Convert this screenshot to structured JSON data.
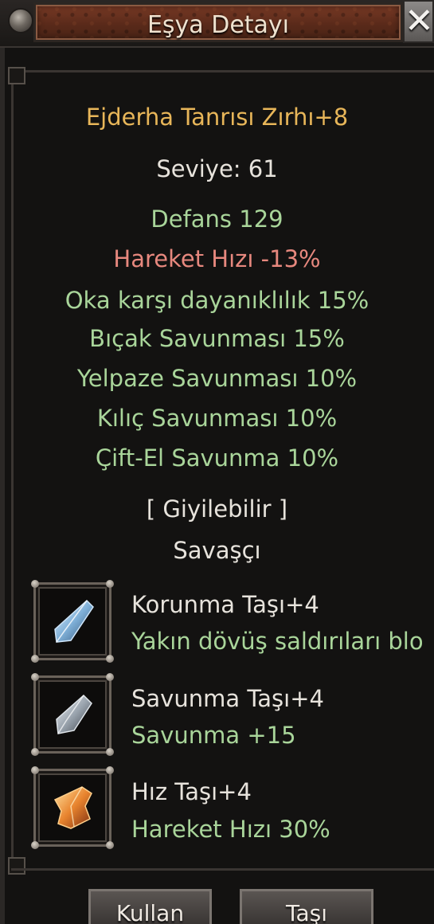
{
  "window": {
    "title": "Eşya Detayı",
    "close_label": "✕"
  },
  "item": {
    "name": "Ejderha Tanrısı Zırhı+8",
    "level": "Seviye: 61",
    "stats": [
      {
        "text": "Defans 129",
        "color": "green"
      },
      {
        "text": "Hareket Hızı -13%",
        "color": "red"
      },
      {
        "text": "Oka karşı dayanıklılık 15%",
        "color": "green"
      },
      {
        "text": "Bıçak Savunması 15%",
        "color": "green"
      },
      {
        "text": "Yelpaze Savunması 10%",
        "color": "green"
      },
      {
        "text": "Kılıç Savunması 10%",
        "color": "green"
      },
      {
        "text": "Çift-El Savunma 10%",
        "color": "green"
      }
    ],
    "wearable": "[ Giyilebilir ]",
    "class": "Savaşçı"
  },
  "stones": [
    {
      "name": "Korunma Taşı+4",
      "description": "Yakın dövüş saldırıları blo",
      "icon": "blue-crystal-icon"
    },
    {
      "name": "Savunma Taşı+4",
      "description": "Savunma +15",
      "icon": "silver-crystal-icon"
    },
    {
      "name": "Hız Taşı+4",
      "description": "Hareket Hızı 30%",
      "icon": "orange-crystal-icon"
    }
  ],
  "buttons": {
    "use": "Kullan",
    "move": "Taşı"
  },
  "colors": {
    "gold": "#e8b659",
    "green": "#a9d59a",
    "red": "#e7887e",
    "white": "#e7e3dc"
  }
}
